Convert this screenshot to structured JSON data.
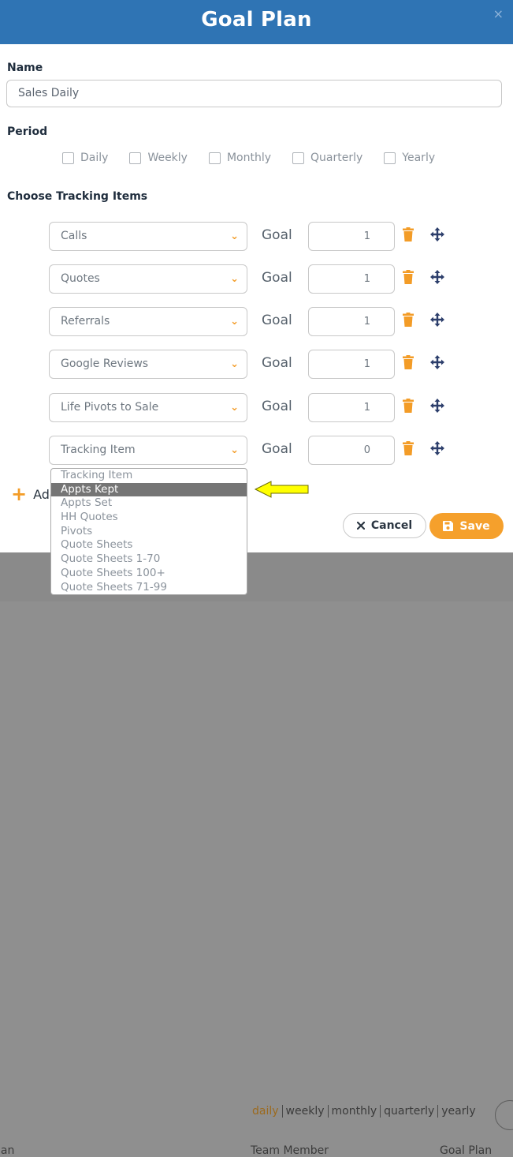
{
  "modal": {
    "title": "Goal Plan",
    "close_label": "×"
  },
  "name": {
    "label": "Name",
    "value": "Sales Daily"
  },
  "period": {
    "label": "Period",
    "options": [
      "Daily",
      "Weekly",
      "Monthly",
      "Quarterly",
      "Yearly"
    ]
  },
  "tracking": {
    "label": "Choose Tracking Items",
    "goal_label": "Goal",
    "rows": [
      {
        "item": "Calls",
        "goal": "1"
      },
      {
        "item": "Quotes",
        "goal": "1"
      },
      {
        "item": "Referrals",
        "goal": "1"
      },
      {
        "item": "Google Reviews",
        "goal": "1"
      },
      {
        "item": "Life Pivots to Sale",
        "goal": "1"
      },
      {
        "item": "Tracking Item",
        "goal": "0"
      }
    ],
    "add_label": "Add"
  },
  "dropdown": {
    "options": [
      "Tracking Item",
      "Appts Kept",
      "Appts Set",
      "HH Quotes",
      "Pivots",
      "Quote Sheets",
      "Quote Sheets 1-70",
      "Quote Sheets 100+",
      "Quote Sheets 71-99"
    ],
    "highlighted": "Appts Kept"
  },
  "actions": {
    "cancel": "Cancel",
    "save": "Save"
  },
  "background": {
    "filters": [
      "daily",
      "weekly",
      "monthly",
      "quarterly",
      "yearly"
    ],
    "columns": [
      "lan",
      "Team Member",
      "Goal Plan"
    ]
  },
  "colors": {
    "header": "#2f74b4",
    "accent": "#f39c27",
    "icon": "#2c3e6b",
    "arrow": "#ffff00"
  }
}
